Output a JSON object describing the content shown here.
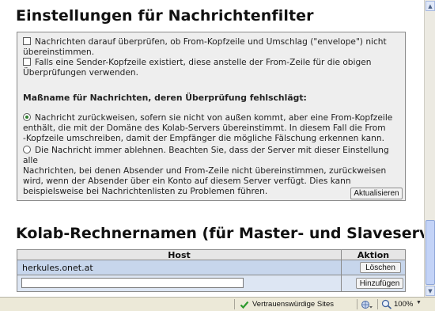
{
  "settings": {
    "title": "Einstellungen für Nachrichtenfilter",
    "check_envelope": "Nachrichten darauf überprüfen, ob From-Kopfzeile und Umschlag (\"envelope\") nicht übereinstimmen.",
    "check_sender_line1": "Falls eine Sender-Kopfzeile existiert, diese anstelle der From-Zeile für die obigen",
    "check_sender_line2": "Überprüfungen verwenden.",
    "measure_heading": "Maßname für Nachrichten, deren Überprüfung fehlschlägt:",
    "option_reject_foreign_l1": "Nachricht zurückweisen, sofern sie nicht von außen kommt, aber eine From-Kopfzeile",
    "option_reject_foreign_l2": "enthält, die mit der Domäne des Kolab-Servers übereinstimmt. In diesem Fall die From",
    "option_reject_foreign_l3": "-Kopfzeile umschreiben, damit der Empfänger die mögliche Fälschung erkennen kann.",
    "option_always_reject_l1": "Die Nachricht immer ablehnen. Beachten Sie, dass der Server mit dieser Einstellung alle",
    "option_always_reject_l2": "Nachrichten, bei denen Absender und From-Zeile nicht übereinstimmen, zurückweisen",
    "option_always_reject_l3": "wird, wenn der Absender über ein Konto auf diesem Server verfügt. Dies kann",
    "option_always_reject_l4": "beispielsweise bei Nachrichtenlisten zu Problemen führen.",
    "update_button": "Aktualisieren"
  },
  "hosts": {
    "title": "Kolab-Rechnernamen (für Master- und Slaveserver)",
    "col_host": "Host",
    "col_action": "Aktion",
    "rows": [
      {
        "host": "herkules.onet.at",
        "action": "Löschen"
      }
    ],
    "new_host_value": "",
    "add_button": "Hinzufügen"
  },
  "statusbar": {
    "zone": "Vertrauenswürdige Sites",
    "zoom": "100%"
  },
  "colors": {
    "panel_bg": "#eeeeee",
    "row_bg": "#c7d6ec",
    "status_bg": "#ece9d8"
  }
}
